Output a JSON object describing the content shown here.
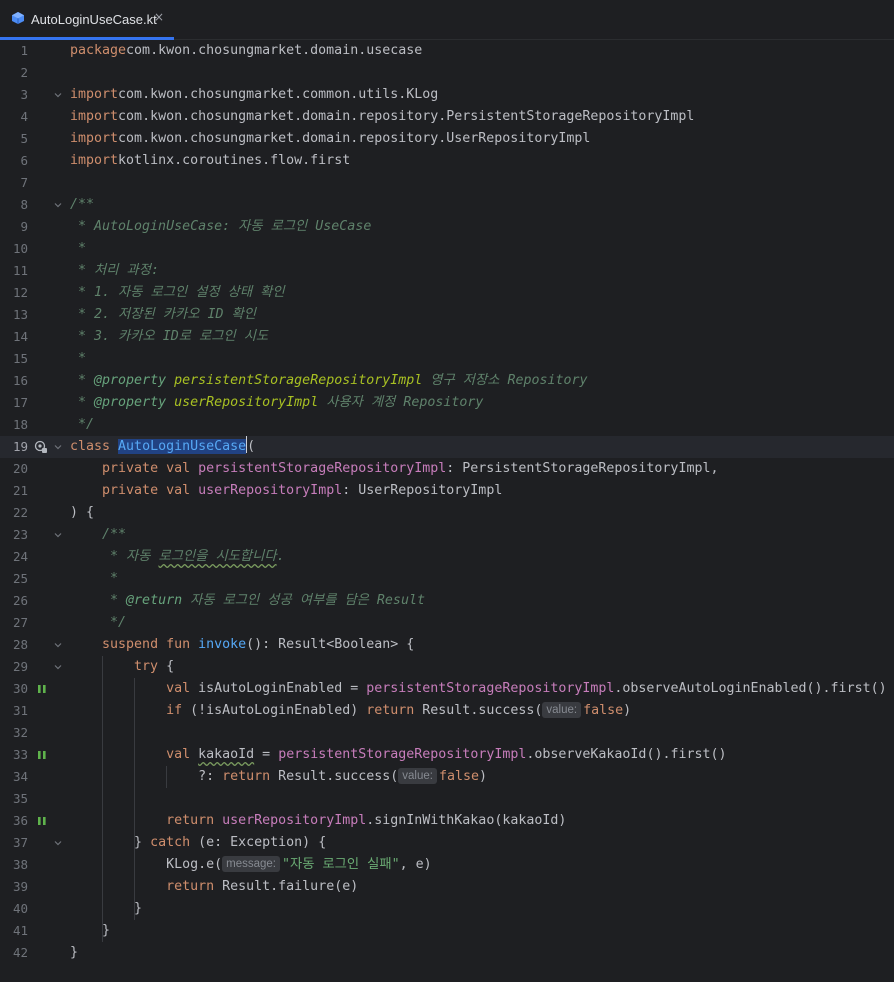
{
  "tab": {
    "filename": "AutoLoginUseCase.kt",
    "close": "×"
  },
  "lines": [
    {
      "n": "1",
      "t": [
        [
          "kw",
          "package"
        ],
        [
          "",
          "com.kwon.chosungmarket.domain.usecase"
        ]
      ]
    },
    {
      "n": "2",
      "t": []
    },
    {
      "n": "3",
      "t": [
        [
          "kw",
          "import"
        ],
        [
          "",
          "com.kwon.chosungmarket.common.utils.KLog"
        ]
      ]
    },
    {
      "n": "4",
      "t": [
        [
          "kw",
          "import"
        ],
        [
          "",
          "com.kwon.chosungmarket.domain.repository.PersistentStorageRepositoryImpl"
        ]
      ]
    },
    {
      "n": "5",
      "t": [
        [
          "kw",
          "import"
        ],
        [
          "",
          "com.kwon.chosungmarket.domain.repository.UserRepositoryImpl"
        ]
      ]
    },
    {
      "n": "6",
      "t": [
        [
          "kw",
          "import"
        ],
        [
          "",
          "kotlinx.coroutines.flow.first"
        ]
      ]
    },
    {
      "n": "7",
      "t": []
    },
    {
      "n": "8",
      "t": [
        [
          "dc",
          "/**"
        ]
      ]
    },
    {
      "n": "9",
      "t": [
        [
          "dc",
          " * AutoLoginUseCase: 자동 로그인 UseCase"
        ]
      ]
    },
    {
      "n": "10",
      "t": [
        [
          "dc",
          " *"
        ]
      ]
    },
    {
      "n": "11",
      "t": [
        [
          "dc",
          " * 처리 과정:"
        ]
      ]
    },
    {
      "n": "12",
      "t": [
        [
          "dc",
          " * 1. 자동 로그인 설정 상태 확인"
        ]
      ]
    },
    {
      "n": "13",
      "t": [
        [
          "dc",
          " * 2. 저장된 카카오 ID 확인"
        ]
      ]
    },
    {
      "n": "14",
      "t": [
        [
          "dc",
          " * 3. 카카오 ID로 로그인 시도"
        ]
      ]
    },
    {
      "n": "15",
      "t": [
        [
          "dc",
          " *"
        ]
      ]
    },
    {
      "n": "16",
      "t": [
        [
          "dc",
          " * "
        ],
        [
          "tag",
          "@property"
        ],
        [
          "dparam",
          " persistentStorageRepositoryImpl"
        ],
        [
          "dc",
          " 영구 저장소 Repository"
        ]
      ]
    },
    {
      "n": "17",
      "t": [
        [
          "dc",
          " * "
        ],
        [
          "tag",
          "@property"
        ],
        [
          "dparam",
          " userRepositoryImpl"
        ],
        [
          "dc",
          " 사용자 계정 Repository"
        ]
      ]
    },
    {
      "n": "18",
      "t": [
        [
          "dc",
          " */"
        ]
      ]
    },
    {
      "n": "19",
      "t": [
        [
          "kw",
          "class "
        ],
        [
          "sel",
          "AutoLoginUseCase"
        ],
        [
          "caret",
          ""
        ],
        [
          "",
          "("
        ]
      ]
    },
    {
      "n": "20",
      "t": [
        [
          "",
          "    "
        ],
        [
          "kw",
          "private val "
        ],
        [
          "fld",
          "persistentStorageRepositoryImpl"
        ],
        [
          "",
          ": PersistentStorageRepositoryImpl,"
        ]
      ]
    },
    {
      "n": "21",
      "t": [
        [
          "",
          "    "
        ],
        [
          "kw",
          "private val "
        ],
        [
          "fld",
          "userRepositoryImpl"
        ],
        [
          "",
          ": UserRepositoryImpl"
        ]
      ]
    },
    {
      "n": "22",
      "t": [
        [
          "",
          ") {"
        ]
      ]
    },
    {
      "n": "23",
      "t": [
        [
          "",
          "    "
        ],
        [
          "dc",
          "/**"
        ]
      ]
    },
    {
      "n": "24",
      "t": [
        [
          "dc",
          "     * 자동 "
        ],
        [
          "dcw",
          "로그인을 시도합니다"
        ],
        [
          "dc",
          "."
        ]
      ]
    },
    {
      "n": "25",
      "t": [
        [
          "dc",
          "     *"
        ]
      ]
    },
    {
      "n": "26",
      "t": [
        [
          "dc",
          "     * "
        ],
        [
          "tag",
          "@return"
        ],
        [
          "dc",
          " 자동 로그인 성공 여부를 담은 Result"
        ]
      ]
    },
    {
      "n": "27",
      "t": [
        [
          "dc",
          "     */"
        ]
      ]
    },
    {
      "n": "28",
      "t": [
        [
          "",
          "    "
        ],
        [
          "kw",
          "suspend fun "
        ],
        [
          "fn",
          "invoke"
        ],
        [
          "",
          "(): Result<Boolean> {"
        ]
      ]
    },
    {
      "n": "29",
      "t": [
        [
          "",
          "        "
        ],
        [
          "kw",
          "try"
        ],
        [
          "",
          " {"
        ]
      ]
    },
    {
      "n": "30",
      "t": [
        [
          "",
          "            "
        ],
        [
          "kw",
          "val "
        ],
        [
          "",
          "isAutoLoginEnabled = "
        ],
        [
          "fld",
          "persistentStorageRepositoryImpl"
        ],
        [
          "",
          ".observeAutoLoginEnabled().first()"
        ]
      ]
    },
    {
      "n": "31",
      "t": [
        [
          "",
          "            "
        ],
        [
          "kw",
          "if "
        ],
        [
          "",
          "(!isAutoLoginEnabled) "
        ],
        [
          "kw",
          "return "
        ],
        [
          "",
          "Result.success("
        ],
        [
          "hint",
          "value:"
        ],
        [
          "kw",
          "false"
        ],
        [
          "",
          ")"
        ]
      ]
    },
    {
      "n": "32",
      "t": []
    },
    {
      "n": "33",
      "t": [
        [
          "",
          "            "
        ],
        [
          "kw",
          "val "
        ],
        [
          "wavy",
          "kakaoId"
        ],
        [
          "",
          " = "
        ],
        [
          "fld",
          "persistentStorageRepositoryImpl"
        ],
        [
          "",
          ".observeKakaoId().first()"
        ]
      ]
    },
    {
      "n": "34",
      "t": [
        [
          "",
          "                ?: "
        ],
        [
          "kw",
          "return "
        ],
        [
          "",
          "Result.success("
        ],
        [
          "hint",
          "value:"
        ],
        [
          "kw",
          "false"
        ],
        [
          "",
          ")"
        ]
      ]
    },
    {
      "n": "35",
      "t": []
    },
    {
      "n": "36",
      "t": [
        [
          "",
          "            "
        ],
        [
          "kw",
          "return "
        ],
        [
          "fld",
          "userRepositoryImpl"
        ],
        [
          "",
          ".signInWithKakao(kakaoId)"
        ]
      ]
    },
    {
      "n": "37",
      "t": [
        [
          "",
          "        } "
        ],
        [
          "kw",
          "catch "
        ],
        [
          "",
          "(e: Exception) {"
        ]
      ]
    },
    {
      "n": "38",
      "t": [
        [
          "",
          "            KLog.e("
        ],
        [
          "hint",
          "message:"
        ],
        [
          "str",
          "\"자동 로그인 실패\""
        ],
        [
          "",
          ", e)"
        ]
      ]
    },
    {
      "n": "39",
      "t": [
        [
          "",
          "            "
        ],
        [
          "kw",
          "return "
        ],
        [
          "",
          "Result.failure(e)"
        ]
      ]
    },
    {
      "n": "40",
      "t": [
        [
          "",
          "        }"
        ]
      ]
    },
    {
      "n": "41",
      "t": [
        [
          "",
          "    }"
        ]
      ]
    },
    {
      "n": "42",
      "t": [
        [
          "",
          "}"
        ]
      ]
    }
  ],
  "current_line": "19",
  "fold_lines": [
    "3",
    "8",
    "19",
    "23",
    "28",
    "29",
    "37"
  ],
  "suspend_lines": [
    "30",
    "33",
    "36"
  ],
  "colors": {
    "background": "#1e1f22",
    "keyword": "#cf8e6d",
    "field": "#c77dbb",
    "function": "#56a8f5",
    "doc_comment": "#5f826b",
    "string": "#6aab73",
    "selection": "#214283",
    "tab_accent": "#3574f0"
  },
  "icons": {
    "tab": "kotlin-file-icon",
    "line19_gutter": "inheritance-icon",
    "suspend_gutter": "suspend-call-icon",
    "fold": "fold-chevron-icon"
  }
}
